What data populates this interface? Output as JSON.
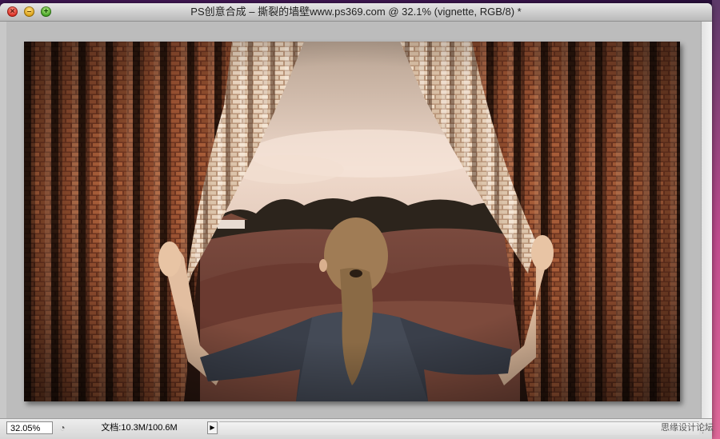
{
  "window": {
    "title": "PS创意合成 – 撕裂的墙壁www.ps369.com @ 32.1% (vignette, RGB/8) *",
    "close_glyph": "×",
    "minimize_glyph": "–",
    "maximize_glyph": "+"
  },
  "statusbar": {
    "zoom": "32.05%",
    "doc_info": "文档:10.3M/100.6M",
    "status_icon": "◔",
    "menu_arrow": "▶",
    "grip": "⋰"
  },
  "watermark": {
    "text": "思缘设计论坛 www.MISSYUAN.COM"
  },
  "icons": {
    "close": "close-icon",
    "minimize": "minimize-icon",
    "maximize": "maximize-icon",
    "status": "status-indicator-icon",
    "arrow": "play-arrow-icon",
    "grip": "resize-grip-icon"
  },
  "colors": {
    "brick": "#7a3a22",
    "sky": "#e8cfc0",
    "field": "#6b3a2f",
    "sweater": "#3a3f4a",
    "hair": "#8a6a45",
    "skin": "#e8c4a4"
  }
}
